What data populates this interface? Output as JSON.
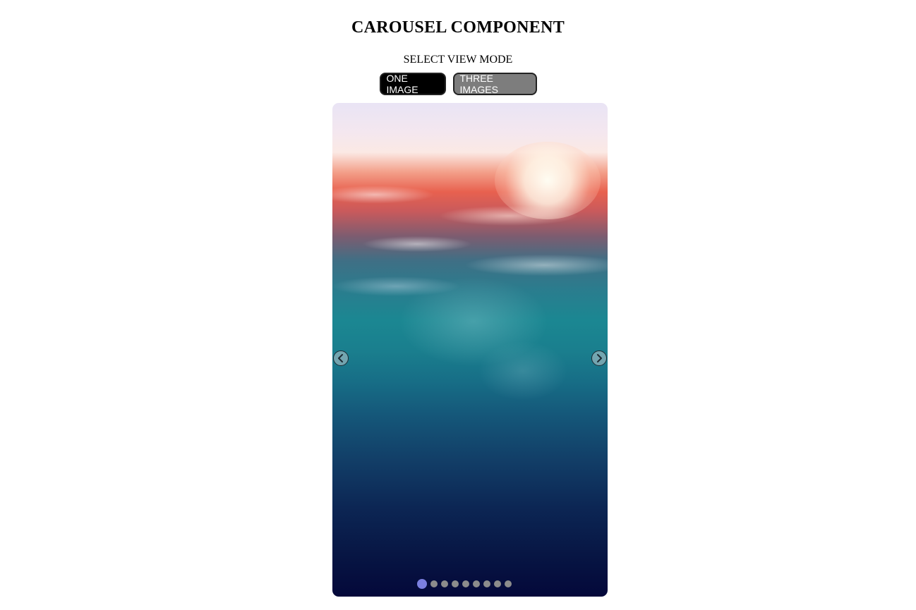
{
  "page": {
    "title": "CAROUSEL COMPONENT"
  },
  "view_mode": {
    "label": "SELECT VIEW MODE",
    "one_image_label": "ONE IMAGE",
    "three_images_label": "THREE IMAGES",
    "selected": "ONE IMAGE"
  },
  "carousel": {
    "image": "underwater-ocean-surface-with-sunlight",
    "prev_icon": "chevron-left-icon",
    "next_icon": "chevron-right-icon",
    "total_slides": 9,
    "active_slide": 1
  },
  "colors": {
    "selected_button": "#000000",
    "unselected_button": "#7d7d7d",
    "active_dot": "#7b7fe0",
    "inactive_dot": "#8c8c8c"
  }
}
